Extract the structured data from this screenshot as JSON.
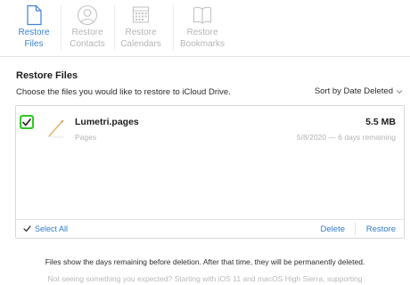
{
  "tabs": [
    {
      "label_line1": "Restore",
      "label_line2": "Files",
      "icon": "document-icon",
      "active": true
    },
    {
      "label_line1": "Restore",
      "label_line2": "Contacts",
      "icon": "contact-icon",
      "active": false
    },
    {
      "label_line1": "Restore",
      "label_line2": "Calendars",
      "icon": "calendar-icon",
      "active": false
    },
    {
      "label_line1": "Restore",
      "label_line2": "Bookmarks",
      "icon": "book-icon",
      "active": false
    }
  ],
  "section": {
    "title": "Restore Files",
    "instructions": "Choose the files you would like to restore to iCloud Drive.",
    "sort_label": "Sort by Date Deleted"
  },
  "files": [
    {
      "name": "Lumetri.pages",
      "kind": "Pages",
      "size": "5.5 MB",
      "meta": "5/8/2020 — 6 days remaining",
      "checked": true,
      "icon": "pages-file-icon"
    }
  ],
  "footer": {
    "select_all": "Select All",
    "delete": "Delete",
    "restore": "Restore"
  },
  "notes": {
    "primary": "Files show the days remaining before deletion. After that time, they will be permanently deleted.",
    "secondary": "Not seeing something you expected? Starting with iOS 11 and macOS High Sierra, supporting"
  },
  "colors": {
    "accent": "#3a83d2",
    "checkbox": "#34c728",
    "muted": "#b5b5ba"
  }
}
